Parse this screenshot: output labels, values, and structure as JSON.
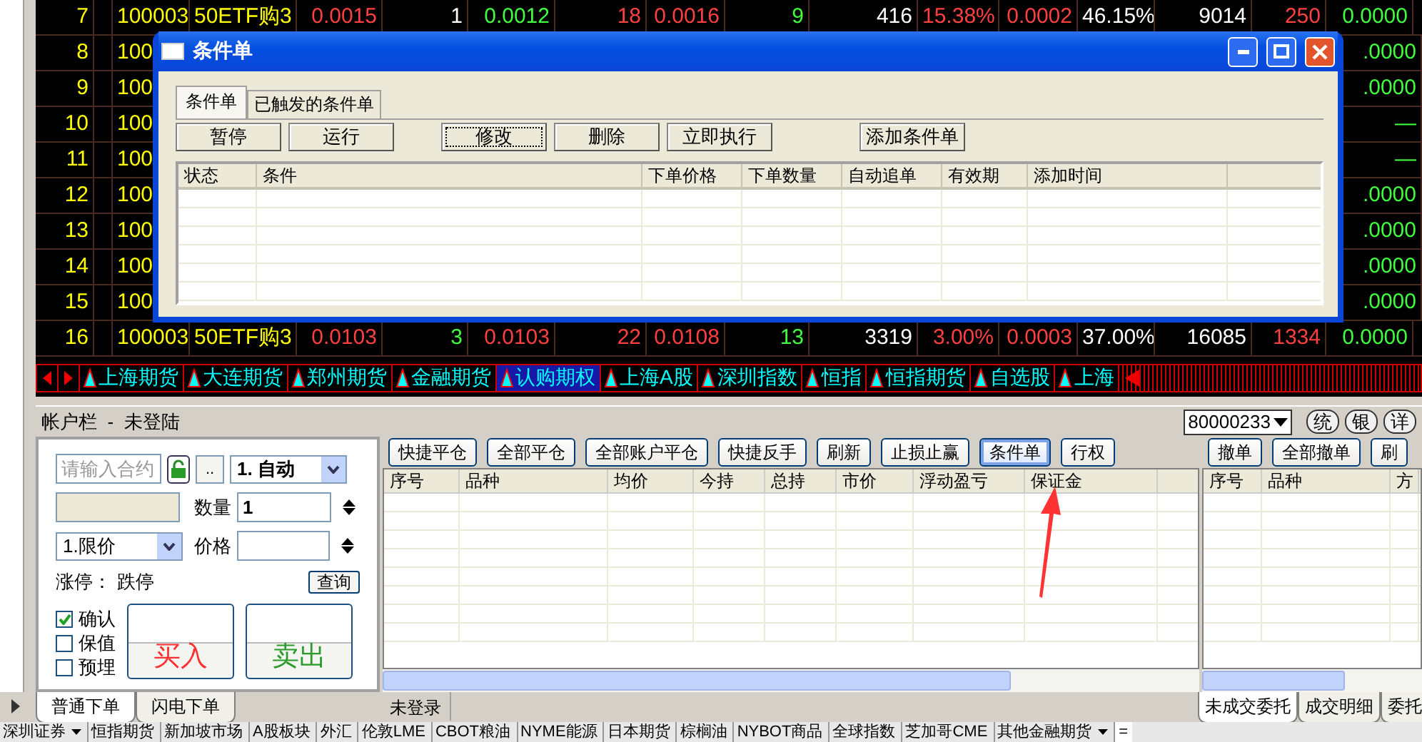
{
  "quote_table": {
    "rows": [
      {
        "kind": "full",
        "cells": [
          {
            "text": "7"
          },
          {
            "text": "100003"
          },
          {
            "text": "50ETF购3"
          },
          {
            "text": "0.0015",
            "up": true,
            "down": false
          },
          {
            "text": "1",
            "up": false,
            "down": false
          },
          {
            "text": "0.0012",
            "up": false,
            "down": true
          },
          {
            "text": "18",
            "up": true,
            "down": false
          },
          {
            "text": "0.0016",
            "up": true,
            "down": false
          },
          {
            "text": "9",
            "up": false,
            "down": true
          },
          {
            "text": "416",
            "up": false,
            "down": false
          },
          {
            "text": "15.38%",
            "up": true,
            "down": false
          },
          {
            "text": "0.0002",
            "up": true,
            "down": false
          },
          {
            "text": "46.15%",
            "up": false,
            "down": false
          },
          {
            "text": "9014",
            "up": false,
            "down": false
          },
          {
            "text": "250",
            "up": true,
            "down": false
          },
          {
            "text": "0.0000",
            "up": false,
            "down": true
          }
        ]
      },
      {
        "kind": "covered",
        "cells": [
          {
            "text": "8"
          },
          {
            "text": "100"
          },
          {
            "text": ".0000",
            "up": false,
            "down": true
          }
        ]
      },
      {
        "kind": "covered",
        "cells": [
          {
            "text": "9"
          },
          {
            "text": "100"
          },
          {
            "text": ".0000",
            "up": false,
            "down": true
          }
        ]
      },
      {
        "kind": "covered",
        "cells": [
          {
            "text": "10"
          },
          {
            "text": "100"
          },
          {
            "text": "—",
            "up": false,
            "down": true
          }
        ]
      },
      {
        "kind": "covered",
        "cells": [
          {
            "text": "11"
          },
          {
            "text": "100"
          },
          {
            "text": "—",
            "up": false,
            "down": true
          }
        ]
      },
      {
        "kind": "covered",
        "cells": [
          {
            "text": "12"
          },
          {
            "text": "100"
          },
          {
            "text": ".0000",
            "up": false,
            "down": true
          }
        ]
      },
      {
        "kind": "covered",
        "cells": [
          {
            "text": "13"
          },
          {
            "text": "100"
          },
          {
            "text": ".0000",
            "up": false,
            "down": true
          }
        ]
      },
      {
        "kind": "covered",
        "cells": [
          {
            "text": "14"
          },
          {
            "text": "100"
          },
          {
            "text": ".0000",
            "up": false,
            "down": true
          }
        ]
      },
      {
        "kind": "covered",
        "cells": [
          {
            "text": "15"
          },
          {
            "text": "100"
          },
          {
            "text": ".0000",
            "up": false,
            "down": true
          }
        ]
      },
      {
        "kind": "full",
        "cells": [
          {
            "text": "16"
          },
          {
            "text": "100003"
          },
          {
            "text": "50ETF购3"
          },
          {
            "text": "0.0103",
            "up": true,
            "down": false
          },
          {
            "text": "3",
            "up": false,
            "down": true
          },
          {
            "text": "0.0103",
            "up": true,
            "down": false
          },
          {
            "text": "22",
            "up": true,
            "down": false
          },
          {
            "text": "0.0108",
            "up": true,
            "down": false
          },
          {
            "text": "13",
            "up": false,
            "down": true
          },
          {
            "text": "3319",
            "up": false,
            "down": false
          },
          {
            "text": "3.00%",
            "up": true,
            "down": false
          },
          {
            "text": "0.0003",
            "up": true,
            "down": false
          },
          {
            "text": "37.00%",
            "up": false,
            "down": false
          },
          {
            "text": "16085",
            "up": false,
            "down": false
          },
          {
            "text": "1334",
            "up": true,
            "down": false
          },
          {
            "text": "0.0000",
            "up": false,
            "down": true
          }
        ]
      }
    ]
  },
  "condition_window": {
    "title": "条件单",
    "tabs": [
      {
        "label": "条件单",
        "selected": true
      },
      {
        "label": "已触发的条件单",
        "selected": false
      }
    ],
    "buttons": [
      {
        "label": "暂停",
        "focused": false
      },
      {
        "label": "运行",
        "focused": false
      },
      {
        "label": "修改",
        "focused": true
      },
      {
        "label": "删除",
        "focused": false
      },
      {
        "label": "立即执行",
        "focused": false
      },
      {
        "label": "添加条件单",
        "focused": false
      }
    ],
    "columns": [
      "状态",
      "条件",
      "下单价格",
      "下单数量",
      "自动追单",
      "有效期",
      "添加时间"
    ]
  },
  "market_tabs": [
    {
      "label": "上海期货",
      "selected": false
    },
    {
      "label": "大连期货",
      "selected": false
    },
    {
      "label": "郑州期货",
      "selected": false
    },
    {
      "label": "金融期货",
      "selected": false
    },
    {
      "label": "认购期权",
      "selected": true
    },
    {
      "label": "上海A股",
      "selected": false
    },
    {
      "label": "深圳指数",
      "selected": false
    },
    {
      "label": "恒指",
      "selected": false
    },
    {
      "label": "恒指期货",
      "selected": false
    },
    {
      "label": "自选股",
      "selected": false
    },
    {
      "label": "上海",
      "selected": false
    }
  ],
  "account_bar": {
    "title": "帐户栏  -  未登陆",
    "account": "80000233",
    "buttons": [
      "统",
      "银",
      "详"
    ]
  },
  "order_panel": {
    "contract_placeholder": "请输入合约",
    "more_button": "..",
    "mode": "1. 自动",
    "quantity_label": "数量",
    "quantity": "1",
    "price_type": "1.限价",
    "price_label": "价格",
    "limit_up": "涨停：",
    "limit_down": "跌停",
    "query_button": "查询",
    "options": [
      {
        "label": "确认",
        "checked": true
      },
      {
        "label": "保值",
        "checked": false
      },
      {
        "label": "预埋",
        "checked": false
      }
    ],
    "buy_button": "买入",
    "sell_button": "卖出"
  },
  "position_panel": {
    "buttons": [
      {
        "label": "快捷平仓",
        "selected": false
      },
      {
        "label": "全部平仓",
        "selected": false
      },
      {
        "label": "全部账户平仓",
        "selected": false
      },
      {
        "label": "快捷反手",
        "selected": false
      },
      {
        "label": "刷新",
        "selected": false
      },
      {
        "label": "止损止赢",
        "selected": false
      },
      {
        "label": "条件单",
        "selected": true
      },
      {
        "label": "行权",
        "selected": false
      }
    ],
    "columns": [
      "序号",
      "品种",
      "均价",
      "今持",
      "总持",
      "市价",
      "浮动盈亏",
      "保证金"
    ],
    "status": "未登录"
  },
  "order_list": {
    "buttons": [
      "撤单",
      "全部撤单",
      "刷"
    ],
    "columns": [
      "序号",
      "品种",
      "方"
    ],
    "tabs": [
      {
        "label": "未成交委托",
        "selected": true
      },
      {
        "label": "成交明细",
        "selected": false
      },
      {
        "label": "委托",
        "selected": false
      }
    ]
  },
  "order_tabs": [
    {
      "label": "普通下单",
      "selected": true
    },
    {
      "label": "闪电下单",
      "selected": false
    }
  ],
  "market_bar": {
    "items": [
      {
        "label": "深圳证券",
        "menu": true
      },
      {
        "label": "恒指期货",
        "menu": false
      },
      {
        "label": "新加坡市场",
        "menu": false
      },
      {
        "label": "A股板块",
        "menu": false
      },
      {
        "label": "外汇",
        "menu": false
      },
      {
        "label": "伦敦LME",
        "menu": false
      },
      {
        "label": "CBOT粮油",
        "menu": false
      },
      {
        "label": "NYME能源",
        "menu": false
      },
      {
        "label": "日本期货",
        "menu": false
      },
      {
        "label": "棕榈油",
        "menu": false
      },
      {
        "label": "NYBOT商品",
        "menu": false
      },
      {
        "label": "全球指数",
        "menu": false
      },
      {
        "label": "芝加哥CME",
        "menu": false
      },
      {
        "label": "其他金融期货",
        "menu": true
      }
    ],
    "end_button": "="
  }
}
